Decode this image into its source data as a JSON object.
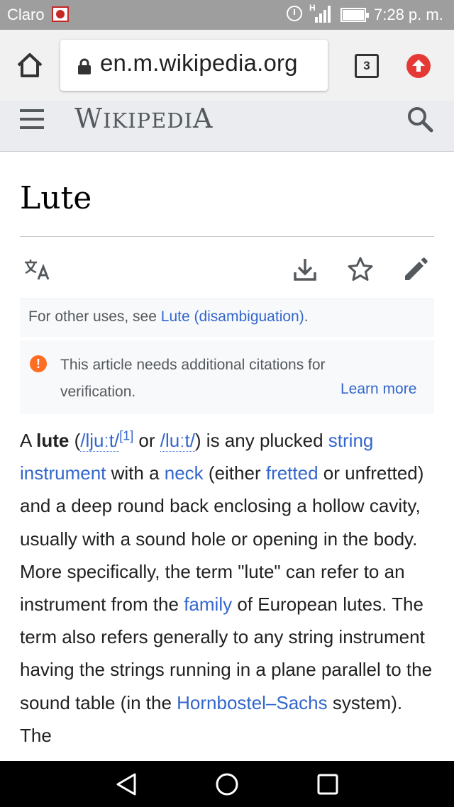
{
  "status_bar": {
    "carrier": "Claro",
    "network": "H",
    "time": "7:28 p. m."
  },
  "browser": {
    "url": "en.m.wikipedia.org",
    "tab_count": "3"
  },
  "wiki_header": {
    "wordmark_first": "W",
    "wordmark_middle": "IKIPEDI",
    "wordmark_last": "A"
  },
  "article": {
    "title": "Lute",
    "hatnote_prefix": "For other uses, see ",
    "hatnote_link": "Lute (disambiguation)",
    "hatnote_suffix": ".",
    "issue_text": "This article needs additional citations for verification.",
    "issue_link": "Learn more",
    "paragraph": {
      "p1": "A ",
      "lute": "lute",
      "p2": " (",
      "ipa1": "/ljuːt/",
      "ref": "[1]",
      "p3": " or ",
      "ipa2": "/luːt/",
      "p4": ") is any plucked ",
      "link_string_instrument": "string instrument",
      "p5": " with a ",
      "link_neck": "neck",
      "p6": " (either ",
      "link_fretted": "fretted",
      "p7": " or unfretted) and a deep round back enclosing a hollow cavity, usually with a sound hole or opening in the body. More specifically, the term \"lute\" can refer to an instrument from the ",
      "link_family": "family",
      "p8": " of European lutes. The term also refers generally to any string instrument having the strings running in a plane parallel to the sound table (in the ",
      "link_hornbostel": "Hornbostel–Sachs",
      "p9": " system). The"
    }
  },
  "colors": {
    "link": "#3366cc",
    "header_bg": "#eaecf0",
    "status_bg": "#9e9e9e",
    "warning": "#ff6d22"
  },
  "icons": [
    "home-icon",
    "lock-icon",
    "tabs-icon",
    "update-icon",
    "menu-icon",
    "search-icon",
    "language-icon",
    "download-icon",
    "star-icon",
    "edit-icon",
    "warning-icon",
    "back-icon",
    "home-nav-icon",
    "recents-icon"
  ]
}
